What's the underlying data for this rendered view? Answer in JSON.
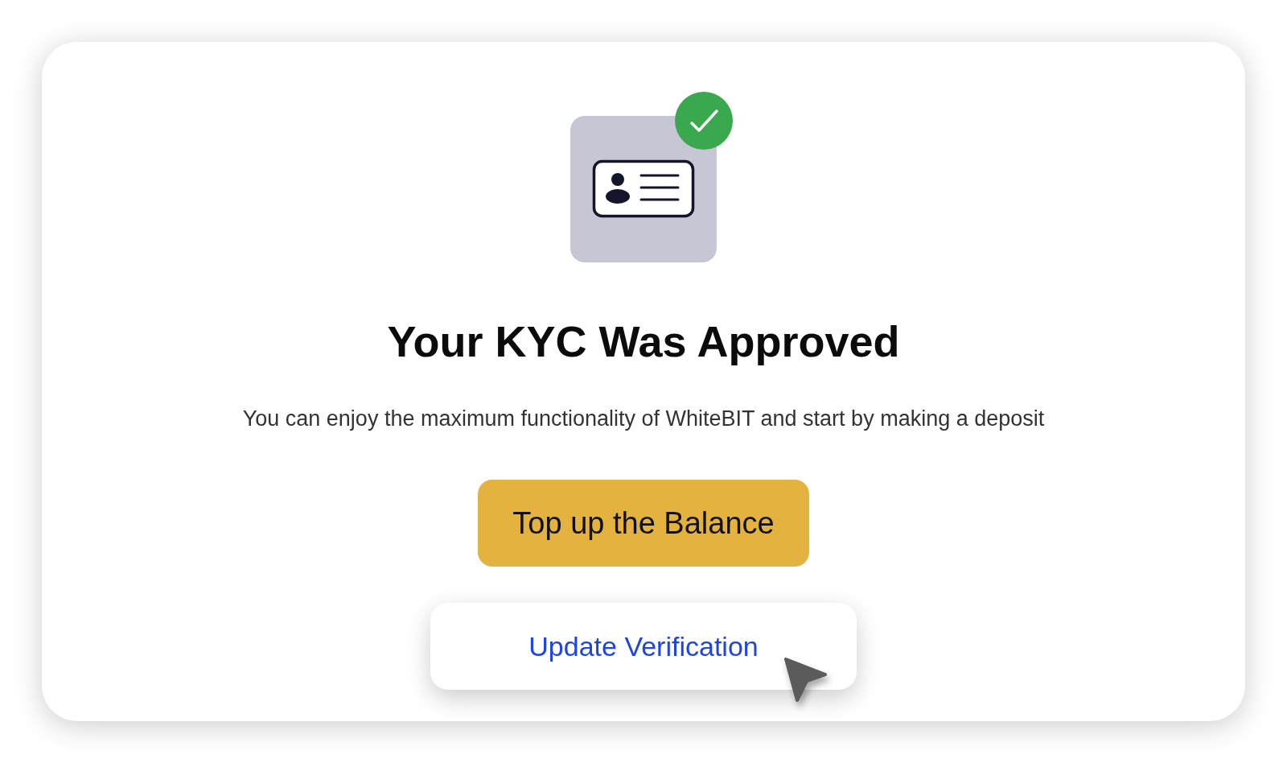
{
  "card": {
    "title": "Your KYC Was Approved",
    "description": "You can enjoy the maximum functionality of WhiteBIT and start by making a deposit",
    "buttons": [
      {
        "label": "Top up the Balance",
        "kind": "primary"
      },
      {
        "label": "Update Verification",
        "kind": "secondary"
      }
    ]
  }
}
